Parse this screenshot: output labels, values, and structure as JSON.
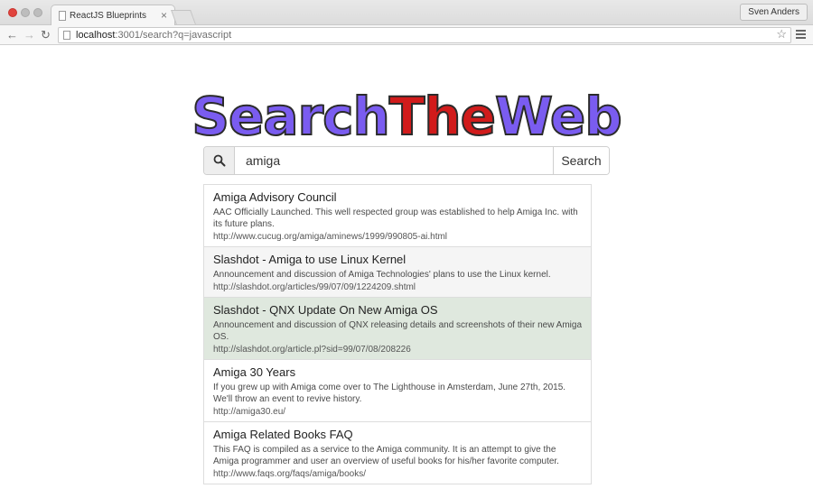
{
  "browser": {
    "tab_title": "ReactJS Blueprints",
    "tab_close": "×",
    "profile_name": "Sven Anders",
    "url_host": "localhost",
    "url_path": ":3001/search?q=javascript"
  },
  "logo": {
    "part1": "Search",
    "part2": "The",
    "part3": "Web",
    "colors": {
      "part1": "#7a5cf0",
      "part2": "#d11b1b",
      "part3": "#7a5cf0"
    }
  },
  "search": {
    "icon": "search-icon",
    "value": "amiga",
    "button_label": "Search"
  },
  "results": [
    {
      "title": "Amiga Advisory Council",
      "description": "AAC Officially Launched. This well respected group was established to help Amiga Inc. with its future plans.",
      "url": "http://www.cucug.org/amiga/aminews/1999/990805-ai.html"
    },
    {
      "title": "Slashdot - Amiga to use Linux Kernel",
      "description": "Announcement and discussion of Amiga Technologies' plans to use the Linux kernel.",
      "url": "http://slashdot.org/articles/99/07/09/1224209.shtml"
    },
    {
      "title": "Slashdot - QNX Update On New Amiga OS",
      "description": "Announcement and discussion of QNX releasing details and screenshots of their new Amiga OS.",
      "url": "http://slashdot.org/article.pl?sid=99/07/08/208226"
    },
    {
      "title": "Amiga 30 Years",
      "description": "If you grew up with Amiga come over to The Lighthouse in Amsterdam, June 27th, 2015. We'll throw an event to revive history.",
      "url": "http://amiga30.eu/"
    },
    {
      "title": "Amiga Related Books FAQ",
      "description": "This FAQ is compiled as a service to the Amiga community. It is an attempt to give the Amiga programmer and user an overview of useful books for his/her favorite computer.",
      "url": "http://www.faqs.org/faqs/amiga/books/"
    }
  ]
}
